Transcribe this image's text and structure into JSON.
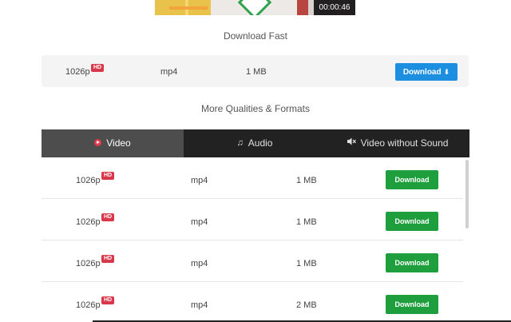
{
  "video": {
    "duration": "00:00:46"
  },
  "fast": {
    "title": "Download Fast",
    "quality": "1026p",
    "badge": "HD",
    "format": "mp4",
    "size": "1 MB",
    "button_label": "Download",
    "button_color": "#1d8fe1"
  },
  "more": {
    "title": "More Qualities & Formats"
  },
  "tabs": [
    {
      "label": "Video",
      "icon": "play-circle-icon",
      "active": true
    },
    {
      "label": "Audio",
      "icon": "music-note-icon",
      "active": false
    },
    {
      "label": "Video without Sound",
      "icon": "muted-speaker-icon",
      "active": false
    }
  ],
  "rows": [
    {
      "quality": "1026p",
      "badge": "HD",
      "format": "mp4",
      "size": "1 MB",
      "button_label": "Download"
    },
    {
      "quality": "1026p",
      "badge": "HD",
      "format": "mp4",
      "size": "1 MB",
      "button_label": "Download"
    },
    {
      "quality": "1026p",
      "badge": "HD",
      "format": "mp4",
      "size": "1 MB",
      "button_label": "Download"
    },
    {
      "quality": "1026p",
      "badge": "HD",
      "format": "mp4",
      "size": "2 MB",
      "button_label": "Download"
    }
  ],
  "colors": {
    "accent_green": "#1f9e3e",
    "hd_badge": "#d9374a",
    "tab_bar": "#222222"
  }
}
